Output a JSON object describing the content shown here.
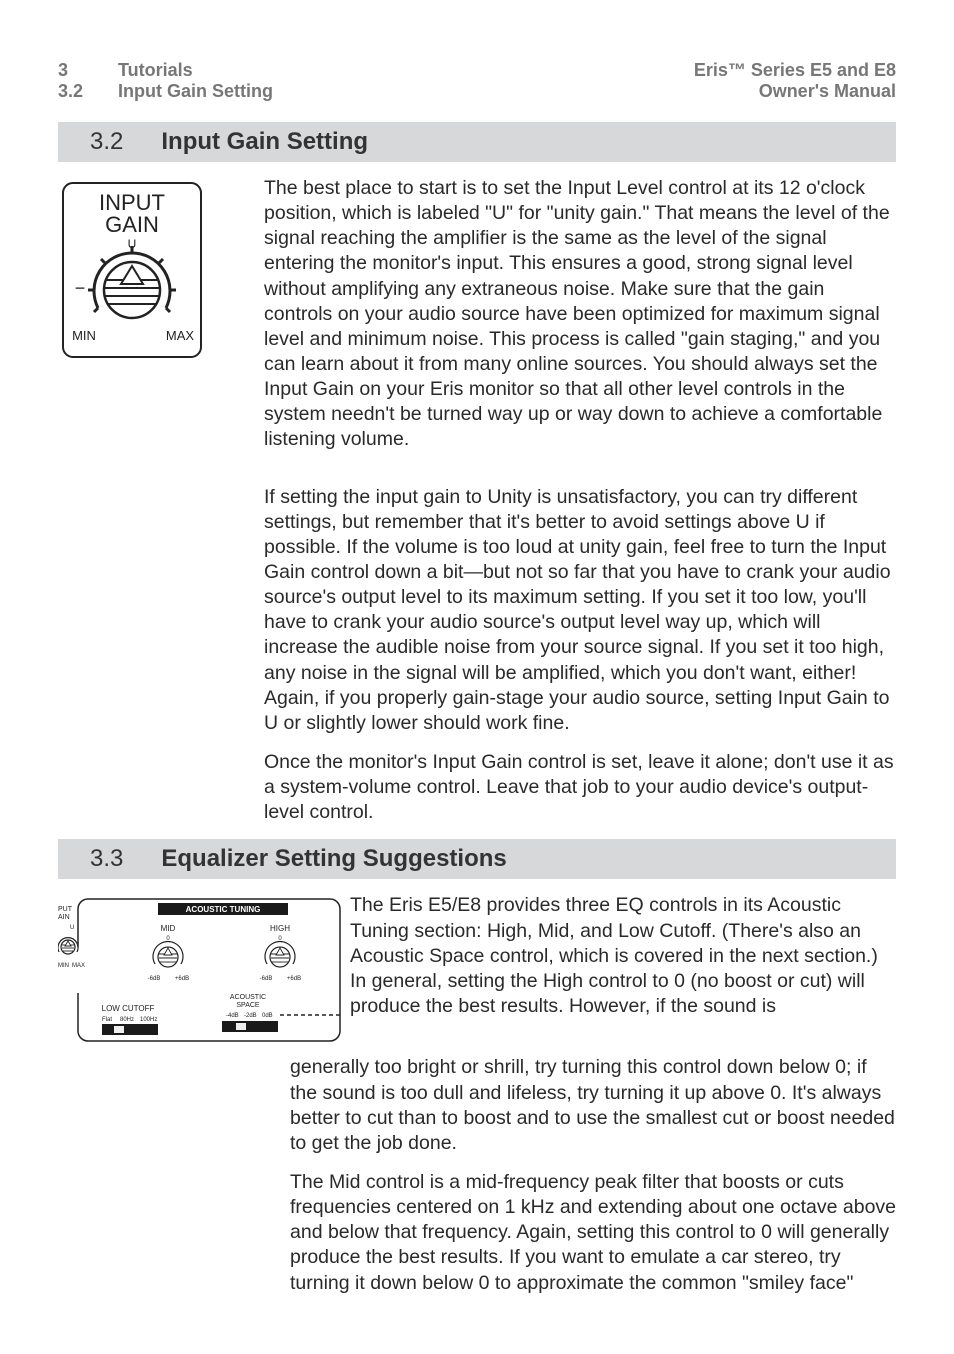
{
  "header": {
    "left": {
      "row1_num": "3",
      "row1_text": "Tutorials",
      "row2_num": "3.2",
      "row2_text": "Input Gain Setting"
    },
    "right": {
      "top": "Eris™ Series E5 and E8",
      "bottom": "Owner's Manual"
    }
  },
  "section_32": {
    "num": "3.2",
    "title": "Input Gain Setting",
    "figure": {
      "label_top": "INPUT",
      "label_bottom": "GAIN",
      "u": "U",
      "min": "MIN",
      "max": "MAX"
    },
    "p1": "The best place to start is to set the Input Level control at its 12 o'clock position, which is labeled \"U\" for \"unity gain.\" That means the level of the signal reaching the amplifier is the same as the level of the signal entering the monitor's input. This ensures a good, strong signal level without amplifying any extraneous noise. Make sure that the gain controls on your audio source have been optimized for maximum signal level and minimum noise. This process is called \"gain staging,\" and you can learn about it from many online sources. You should always set the Input Gain on your Eris monitor so that all other level controls in the system needn't be turned way up or way down to achieve a comfortable listening volume.",
    "p2": "If setting the input gain to Unity is unsatisfactory, you can try different settings, but remember that it's better to avoid settings above U if possible. If the volume is too loud at unity gain, feel free to turn the Input Gain control down a bit—but not so far that you have to crank your audio source's output level to its maximum setting. If you set it too low, you'll have to crank your audio source's output level way up, which will increase the audible noise from your source signal. If you set it too high, any noise in the signal will be amplified, which you don't want, either! Again, if you properly gain-stage your audio source, setting Input Gain to U or slightly lower should work fine.",
    "p3": "Once the monitor's Input Gain control is set, leave it alone; don't use it as a system-volume control. Leave that job to your audio device's output-level control."
  },
  "section_33": {
    "num": "3.3",
    "title": "Equalizer Setting Suggestions",
    "figure": {
      "put_ain": "PUT\nAIN",
      "u": "U",
      "min": "MIN",
      "max": "MAX",
      "banner": "ACOUSTIC TUNING",
      "mid": "MID",
      "high": "HIGH",
      "m6": "-6dB",
      "p6": "+6dB",
      "acoustic_space": "ACOUSTIC\nSPACE",
      "low_cutoff": "LOW CUTOFF",
      "fl": "Flat",
      "f80": "80Hz",
      "f100": "100Hz",
      "as_m4": "-4dB",
      "as_m2": "-2dB",
      "as_0": "0dB"
    },
    "p1": "The Eris E5/E8 provides three EQ controls in its Acoustic Tuning section: High, Mid, and Low Cutoff. (There's also an Acoustic Space control, which is covered in the next section.) In general, setting the High control to 0 (no boost or cut) will produce the best results. However, if the sound is",
    "p1b": "generally too bright or shrill, try turning this control down below 0; if the sound is too dull and lifeless, try turning it up above 0. It's always better to cut than to boost and to use the smallest cut or boost needed to get the job done.",
    "p2": "The Mid control is a mid-frequency peak filter that boosts or cuts frequencies centered on 1 kHz and extending about one octave above and below that frequency. Again, setting this control to 0 will generally produce the best results. If you want to emulate a car stereo, try turning it down below 0 to approximate the common \"smiley face\""
  }
}
